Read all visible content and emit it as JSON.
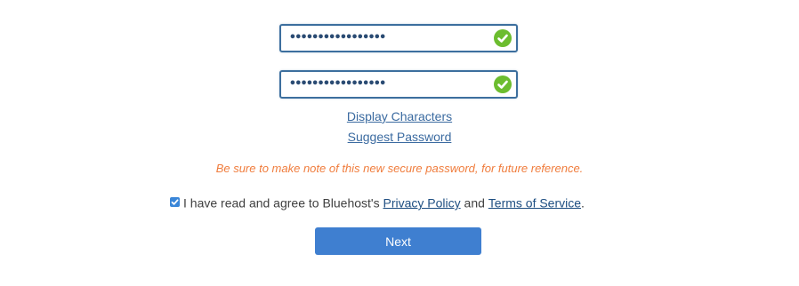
{
  "password_fields": [
    {
      "value": "•••••••••••••••••",
      "status_icon": "check-circle-icon"
    },
    {
      "value": "•••••••••••••••••",
      "status_icon": "check-circle-icon"
    }
  ],
  "links": {
    "display_characters": "Display Characters",
    "suggest_password": "Suggest Password"
  },
  "note": "Be sure to make note of this new secure password, for future reference.",
  "agreement": {
    "checked": true,
    "prefix": "I have read and agree to Bluehost's ",
    "privacy_policy": "Privacy Policy",
    "and": " and ",
    "terms_of_service": "Terms of Service",
    "suffix": "."
  },
  "next_button": "Next",
  "colors": {
    "field_border": "#3d6f9e",
    "check_green": "#6cbd2f",
    "note_orange": "#f07c3c",
    "button_blue": "#3f7fd0",
    "link_blue": "#3a6aa0"
  }
}
